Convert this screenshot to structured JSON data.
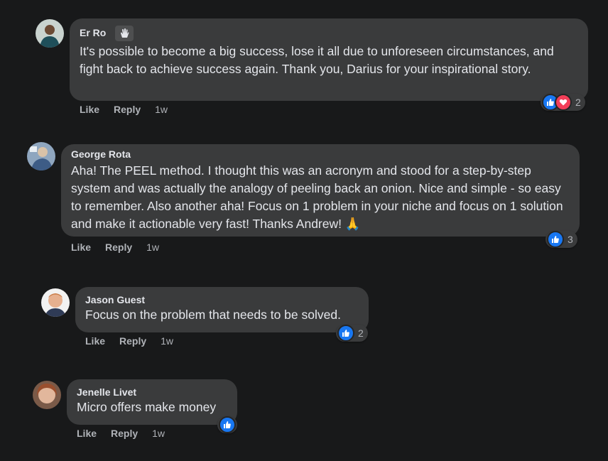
{
  "comments": [
    {
      "author": "Er Ro",
      "text": "It's possible to become a big success, lose it all due to unforeseen circumstances, and fight back to achieve success again. Thank you, Darius for your inspirational story.",
      "actions": {
        "like": "Like",
        "reply": "Reply",
        "time": "1w"
      },
      "reaction_count": "2"
    },
    {
      "author": "George Rota",
      "text": "Aha! The PEEL method. I thought this was an acronym and stood for a step-by-step system and was actually the analogy of peeling back an onion. Nice and simple - so easy to remember. Also another aha! Focus on 1 problem in your niche and focus on 1 solution and make it actionable very fast! Thanks Andrew! 🙏",
      "actions": {
        "like": "Like",
        "reply": "Reply",
        "time": "1w"
      },
      "reaction_count": "3"
    },
    {
      "author": "Jason Guest",
      "text": "Focus on the problem that needs to be solved.",
      "actions": {
        "like": "Like",
        "reply": "Reply",
        "time": "1w"
      },
      "reaction_count": "2"
    },
    {
      "author": "Jenelle Livet",
      "text": "Micro offers make money",
      "actions": {
        "like": "Like",
        "reply": "Reply",
        "time": "1w"
      },
      "reaction_count": ""
    }
  ],
  "colors": {
    "background": "#18191a",
    "bubble": "#3a3b3c",
    "like_blue": "#1877f2",
    "love_red": "#f33e58",
    "secondary_text": "#b0b3b8"
  }
}
